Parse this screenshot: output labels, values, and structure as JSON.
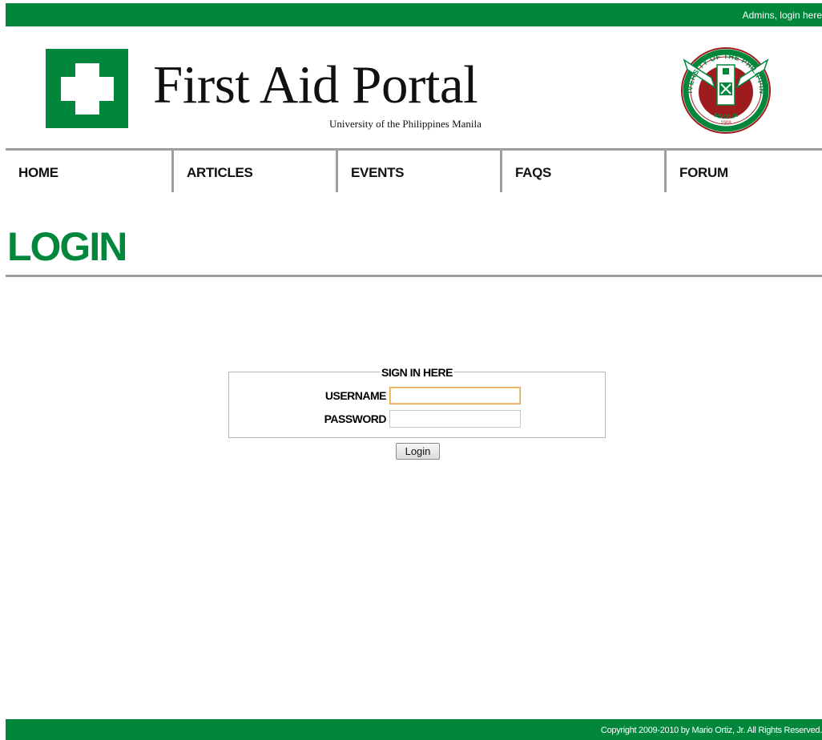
{
  "header": {
    "admin_link": "Admins, login here",
    "title": "First Aid Portal",
    "subtitle": "University of the Philippines Manila",
    "logo_icon": "first-aid-cross-icon",
    "seal_icon": "up-manila-seal-icon",
    "seal_text_top": "UNIVERSITY OF THE PHILIPPINES",
    "seal_text_bottom": "MANILA",
    "seal_year": "1908"
  },
  "nav": {
    "items": [
      {
        "label": "HOME"
      },
      {
        "label": "ARTICLES"
      },
      {
        "label": "EVENTS"
      },
      {
        "label": "FAQS"
      },
      {
        "label": "FORUM"
      }
    ]
  },
  "main": {
    "heading": "LOGIN",
    "form": {
      "legend": "SIGN IN HERE",
      "username_label": "USERNAME",
      "username_value": "",
      "password_label": "PASSWORD",
      "password_value": "",
      "submit_label": "Login"
    }
  },
  "footer": {
    "copyright": "Copyright 2009-2010 by Mario Ortiz, Jr. All Rights Reserved."
  },
  "colors": {
    "brand_green": "#00873c",
    "rule_gray": "#9e9e9e",
    "seal_red": "#9e1b1e"
  }
}
